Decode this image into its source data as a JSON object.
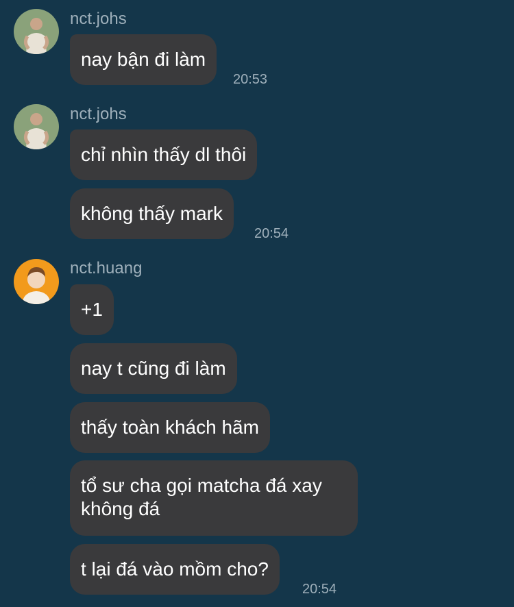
{
  "groups": [
    {
      "sender": "nct.johs",
      "avatar": "person-photo-icon",
      "messages": [
        "nay bận đi làm"
      ],
      "time": "20:53"
    },
    {
      "sender": "nct.johs",
      "avatar": "person-photo-icon",
      "messages": [
        "chỉ nhìn thấy dl thôi",
        "không thấy mark"
      ],
      "time": "20:54"
    },
    {
      "sender": "nct.huang",
      "avatar": "person-photo-icon",
      "messages": [
        "+1",
        "nay t cũng đi làm",
        "thấy toàn khách hãm",
        "tổ sư cha gọi matcha đá xay",
        "không đá",
        "t lại đá vào mồm cho?"
      ],
      "time": "20:54"
    }
  ],
  "colors": {
    "background": "#14364a",
    "bubble": "#3a3a3c",
    "meta_text": "#9fb0bb",
    "message_text": "#ffffff"
  }
}
